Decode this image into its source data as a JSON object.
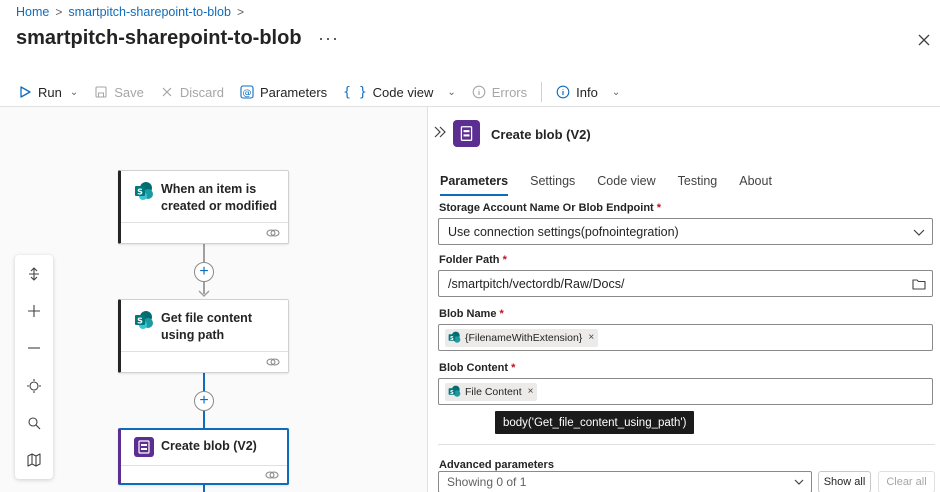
{
  "breadcrumb": {
    "home": "Home",
    "current": "smartpitch-sharepoint-to-blob"
  },
  "page_title": "smartpitch-sharepoint-to-blob",
  "more_label": "···",
  "toolbar": {
    "run": "Run",
    "save": "Save",
    "discard": "Discard",
    "parameters": "Parameters",
    "code_view": "Code view",
    "errors": "Errors",
    "info": "Info"
  },
  "nodes": [
    {
      "title": "When an item is created or modified",
      "icon": "sharepoint-icon"
    },
    {
      "title": "Get file content using path",
      "icon": "sharepoint-icon"
    },
    {
      "title": "Create blob (V2)",
      "icon": "azure-blob-icon"
    }
  ],
  "zoom_controls": [
    "fit-vertical-icon",
    "zoom-in-icon",
    "zoom-out-icon",
    "fit-view-icon",
    "search-icon",
    "minimap-icon"
  ],
  "panel": {
    "title": "Create blob (V2)",
    "tabs": [
      "Parameters",
      "Settings",
      "Code view",
      "Testing",
      "About"
    ],
    "active_tab": "Parameters",
    "fields": {
      "storage": {
        "label": "Storage Account Name Or Blob Endpoint",
        "value": "Use connection settings(pofnointegration)"
      },
      "folder": {
        "label": "Folder Path",
        "value": "/smartpitch/vectordb/Raw/Docs/"
      },
      "blob_name": {
        "label": "Blob Name",
        "token": "{FilenameWithExtension}"
      },
      "blob_content": {
        "label": "Blob Content",
        "token": "File Content"
      }
    },
    "required_mark": "*",
    "token_remove": "×",
    "tooltip": "body('Get_file_content_using_path')",
    "advanced": {
      "label": "Advanced parameters",
      "select_value": "Showing 0 of 1",
      "show_all": "Show all",
      "clear_all": "Clear all"
    }
  },
  "colors": {
    "accent": "#0f6cbd",
    "blob_purple": "#5c2e91",
    "sharepoint_teal": "#038387"
  }
}
